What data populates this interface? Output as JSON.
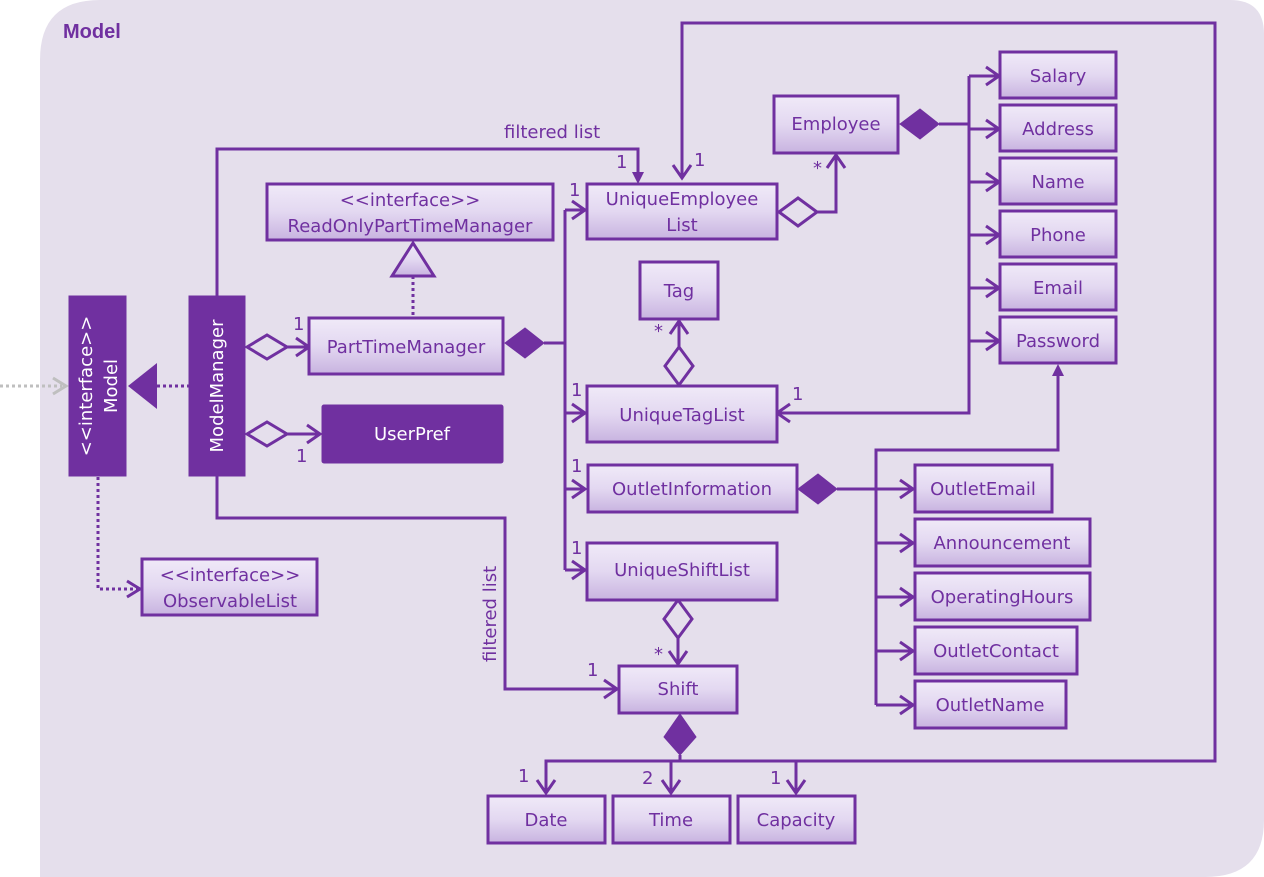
{
  "package": {
    "title": "Model"
  },
  "colors": {
    "primary": "#7030a0",
    "background": "#e5dfec",
    "box_top": "#f0eaf8",
    "box_bottom": "#c8b3e0",
    "dependency_gray": "#bfbfbf"
  },
  "classes": {
    "model": {
      "stereotype": "<<interface>>",
      "name": "Model"
    },
    "model_manager": {
      "name": "ModelManager"
    },
    "read_only_ptm": {
      "stereotype": "<<interface>>",
      "name": "ReadOnlyPartTimeManager"
    },
    "part_time_manager": {
      "name": "PartTimeManager"
    },
    "user_pref": {
      "name": "UserPref"
    },
    "observable_list": {
      "stereotype": "<<interface>>",
      "name": "ObservableList"
    },
    "unique_employee_list": {
      "name_line1": "UniqueEmployee",
      "name_line2": "List"
    },
    "employee": {
      "name": "Employee"
    },
    "tag": {
      "name": "Tag"
    },
    "unique_tag_list": {
      "name": "UniqueTagList"
    },
    "outlet_information": {
      "name": "OutletInformation"
    },
    "unique_shift_list": {
      "name": "UniqueShiftList"
    },
    "shift": {
      "name": "Shift"
    },
    "salary": {
      "name": "Salary"
    },
    "address": {
      "name": "Address"
    },
    "name": {
      "name": "Name"
    },
    "phone": {
      "name": "Phone"
    },
    "email": {
      "name": "Email"
    },
    "password": {
      "name": "Password"
    },
    "outlet_email": {
      "name": "OutletEmail"
    },
    "announcement": {
      "name": "Announcement"
    },
    "operating_hours": {
      "name": "OperatingHours"
    },
    "outlet_contact": {
      "name": "OutletContact"
    },
    "outlet_name": {
      "name": "OutletName"
    },
    "date": {
      "name": "Date"
    },
    "time": {
      "name": "Time"
    },
    "capacity": {
      "name": "Capacity"
    }
  },
  "edges": {
    "filtered_list_top": "filtered list",
    "filtered_list_side": "filtered list"
  },
  "multiplicities": {
    "ptm_from_mm": "1",
    "userpref_from_mm": "1",
    "uel_filtered": "1",
    "uel_shift_loop": "1",
    "uel_from_ptm": "1",
    "employee_many": "*",
    "tag_many": "*",
    "utl_from_ptm": "1",
    "utl_from_employee": "1",
    "oi_from_ptm": "1",
    "usl_from_ptm": "1",
    "shift_many": "*",
    "shift_filtered": "1",
    "date": "1",
    "time": "2",
    "capacity": "1"
  }
}
